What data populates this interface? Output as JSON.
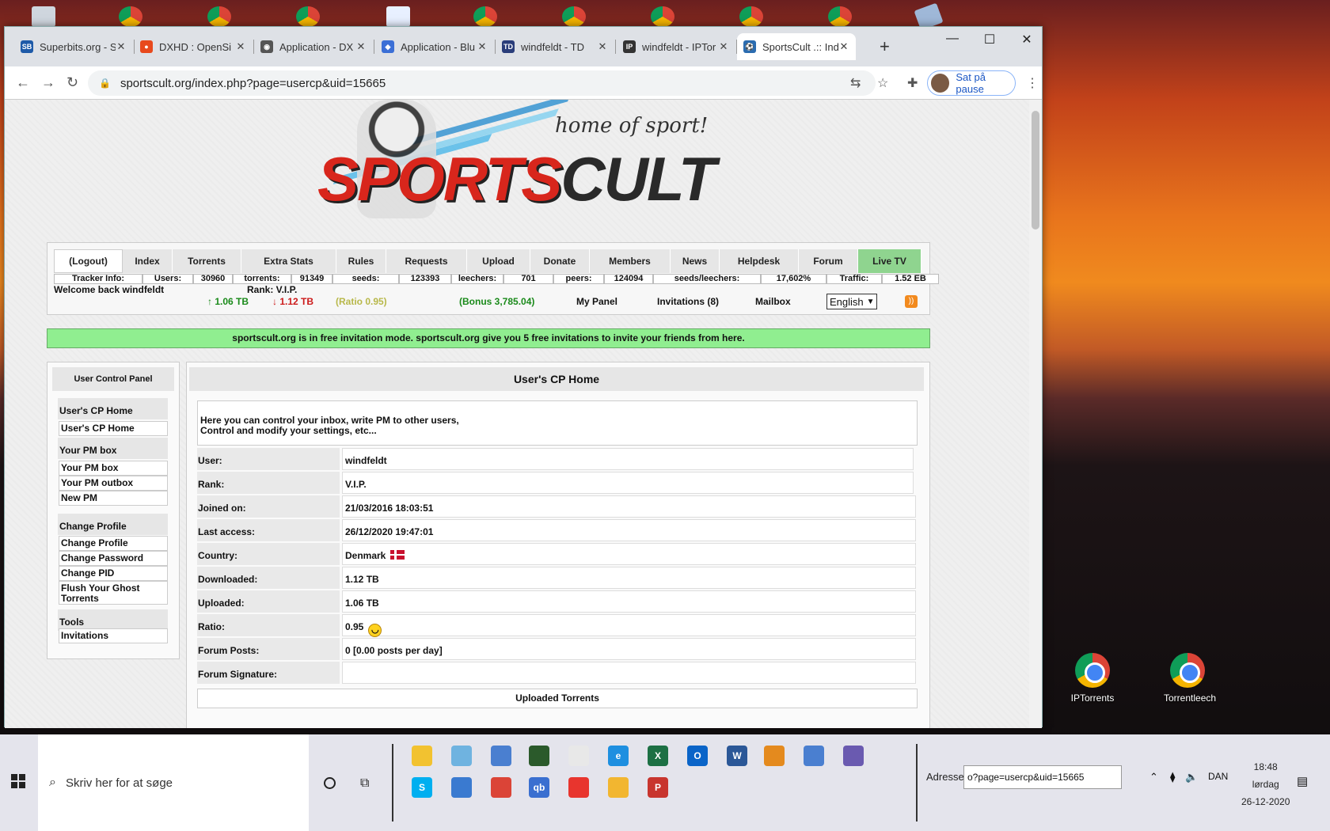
{
  "desktop": {
    "icons": [
      {
        "label": "IPTorrents"
      },
      {
        "label": "Torrentleech"
      }
    ]
  },
  "browser": {
    "tabs": [
      {
        "title": "Superbits.org - S",
        "fav": "SB",
        "color": "#1e5aa8"
      },
      {
        "title": "DXHD : OpenSi",
        "fav": "●",
        "color": "#e8491d"
      },
      {
        "title": "Application - DX",
        "fav": "◉",
        "color": "#555555"
      },
      {
        "title": "Application - Blu",
        "fav": "◆",
        "color": "#3b6fd6"
      },
      {
        "title": "windfeldt - TD",
        "fav": "TD",
        "color": "#2a3d7a"
      },
      {
        "title": "windfeldt - IPTor",
        "fav": "IP",
        "color": "#333333"
      },
      {
        "title": "SportsCult .:: Ind",
        "fav": "⚽",
        "color": "#2b6cb0"
      }
    ],
    "url": "sportscult.org/index.php?page=usercp&uid=15665",
    "profile_label": "Sat på pause"
  },
  "site": {
    "slogan": "home of sport!",
    "logo_sp": "SPORTS",
    "logo_ct": "CULT",
    "menu": [
      "(Logout)",
      "Index",
      "Torrents",
      "Extra Stats",
      "Rules",
      "Requests",
      "Upload",
      "Donate",
      "Members",
      "News",
      "Helpdesk",
      "Forum",
      "Live TV"
    ],
    "stats": [
      "Tracker Info:",
      "Users:",
      "30960",
      "torrents:",
      "91349",
      "seeds:",
      "123393",
      "leechers:",
      "701",
      "peers:",
      "124094",
      "seeds/leechers:",
      "17,602%",
      "Traffic:",
      "1.52 EB"
    ],
    "welcome": "Welcome back windfeldt",
    "rank": "Rank: V.I.P.",
    "up": "↑ 1.06 TB",
    "down": "↓ 1.12 TB",
    "ratio": "(Ratio 0.95)",
    "bonus": "(Bonus 3,785.04)",
    "my_panel": "My Panel",
    "invitations": "Invitations (8)",
    "mailbox": "Mailbox",
    "language": "English",
    "notice": "sportscult.org is in free invitation mode. sportscult.org give you 5 free invitations to invite your friends from here."
  },
  "sidebar": {
    "title": "User Control Panel",
    "items": [
      {
        "type": "h",
        "label": "User's CP Home"
      },
      {
        "type": "l",
        "label": "User's CP Home"
      },
      {
        "type": "h",
        "label": "Your PM box"
      },
      {
        "type": "l",
        "label": "Your PM box"
      },
      {
        "type": "l",
        "label": "Your PM outbox"
      },
      {
        "type": "l",
        "label": "New PM"
      },
      {
        "type": "h",
        "label": "Change Profile"
      },
      {
        "type": "l",
        "label": "Change Profile"
      },
      {
        "type": "l",
        "label": "Change Password"
      },
      {
        "type": "l",
        "label": "Change PID"
      },
      {
        "type": "l",
        "label": "Flush Your Ghost Torrents"
      },
      {
        "type": "h",
        "label": "Tools"
      },
      {
        "type": "l",
        "label": "Invitations"
      }
    ]
  },
  "main": {
    "title": "User's CP Home",
    "intro_line1": "Here you can control your inbox, write PM to other users,",
    "intro_line2": "Control and modify your settings, etc...",
    "rows": [
      {
        "label": "User:",
        "value": "windfeldt"
      },
      {
        "label": "Rank:",
        "value": "V.I.P."
      },
      {
        "label": "Joined on:",
        "value": "21/03/2016 18:03:51"
      },
      {
        "label": "Last access:",
        "value": "26/12/2020 19:47:01"
      },
      {
        "label": "Country:",
        "value": "Denmark"
      },
      {
        "label": "Downloaded:",
        "value": "1.12 TB"
      },
      {
        "label": "Uploaded:",
        "value": "1.06 TB"
      },
      {
        "label": "Ratio:",
        "value": "0.95"
      },
      {
        "label": "Forum Posts:",
        "value": "0 [0.00 posts per day]"
      },
      {
        "label": "Forum Signature:",
        "value": ""
      }
    ],
    "uploaded_torrents": "Uploaded Torrents"
  },
  "taskbar": {
    "search_placeholder": "Skriv her for at søge",
    "address_label": "Adresse",
    "address_value": "o?page=usercp&uid=15665",
    "lang": "DAN",
    "time": "18:48",
    "day": "lørdag",
    "date": "26-12-2020"
  }
}
